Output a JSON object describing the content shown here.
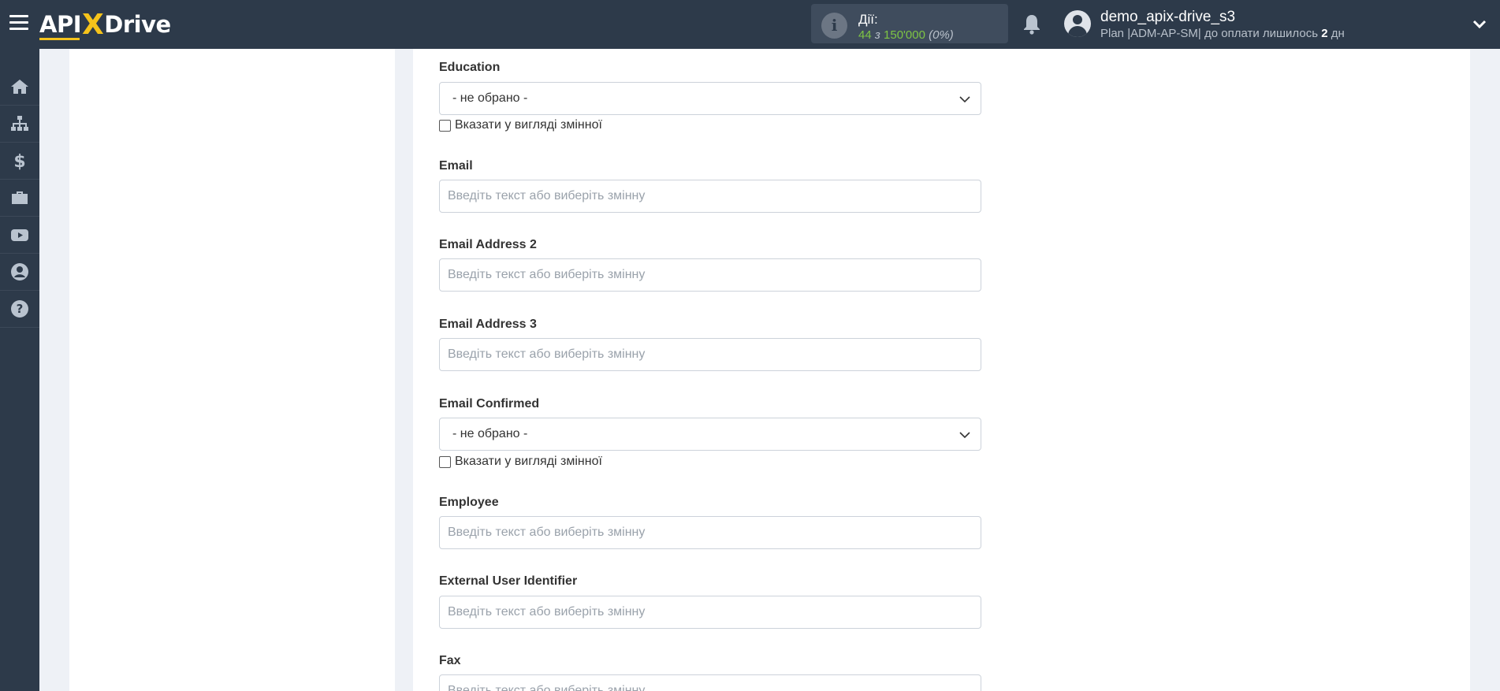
{
  "header": {
    "logo": {
      "left": "API",
      "x": "X",
      "right": "Drive"
    },
    "actions": {
      "label": "Дії:",
      "used": "44",
      "of": "з",
      "total": "150'000",
      "percent": "(0%)"
    },
    "user": {
      "name": "demo_apix-drive_s3",
      "plan_prefix": "Plan |ADM-AP-SM| до оплати лишилось ",
      "days": "2",
      "days_suffix": " дн"
    }
  },
  "sidebar": {
    "items": [
      {
        "icon": "home-icon"
      },
      {
        "icon": "sitemap-icon"
      },
      {
        "icon": "dollar-icon"
      },
      {
        "icon": "briefcase-icon"
      },
      {
        "icon": "youtube-icon"
      },
      {
        "icon": "user-circle-icon"
      },
      {
        "icon": "question-circle-icon"
      }
    ]
  },
  "form": {
    "placeholder": "Введіть текст або виберіть змінну",
    "select_default": "- не обрано -",
    "as_variable_label": "Вказати у вигляді змінної",
    "fields": {
      "education": "Education",
      "email": "Email",
      "email2": "Email Address 2",
      "email3": "Email Address 3",
      "email_confirmed": "Email Confirmed",
      "employee": "Employee",
      "external_id": "External User Identifier",
      "fax": "Fax"
    }
  },
  "colors": {
    "header_bg": "#2d3a4a",
    "accent_yellow": "#f5c31b",
    "actions_green": "#7ec544",
    "page_bg": "#eef1f6"
  }
}
